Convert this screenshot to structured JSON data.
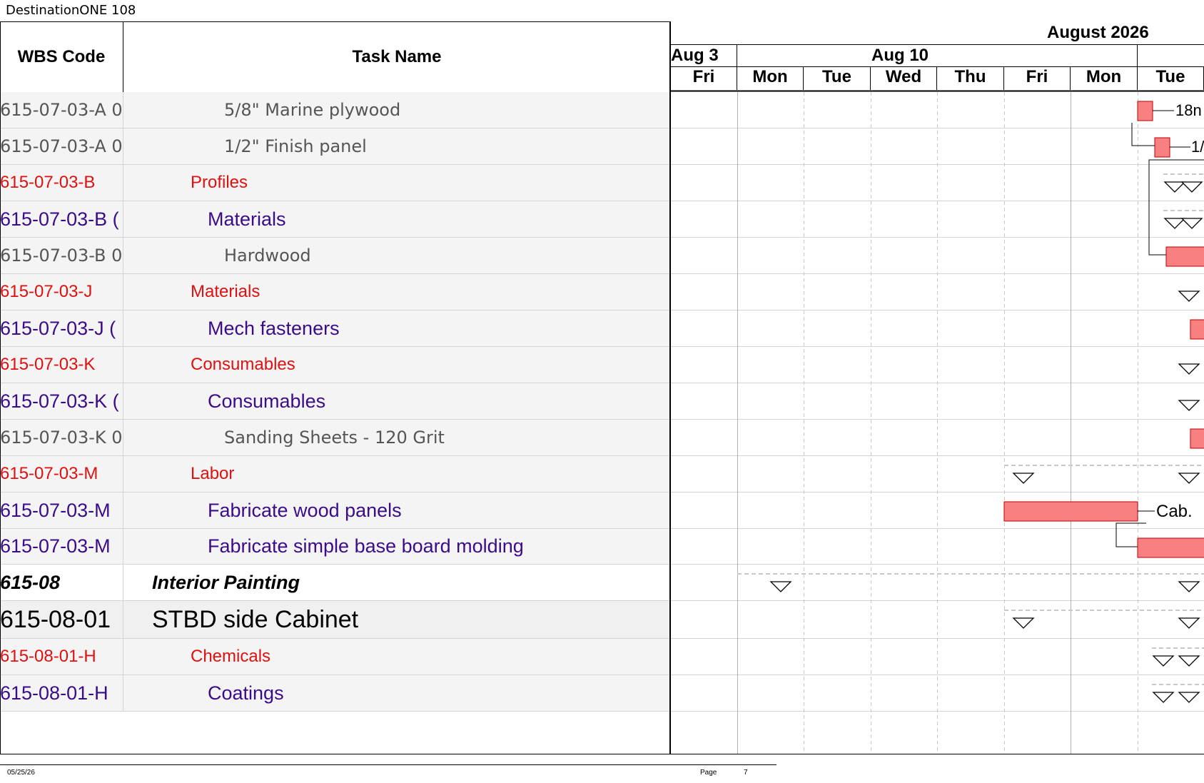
{
  "app": {
    "title": "DestinationONE 108"
  },
  "columns": {
    "wbs": "WBS Code",
    "task": "Task Name"
  },
  "timeline": {
    "month": "August 2026",
    "weeks": [
      "Aug 3",
      "Aug 10"
    ],
    "days": [
      "Fri",
      "Mon",
      "Tue",
      "Wed",
      "Thu",
      "Fri",
      "Mon",
      "Tue"
    ]
  },
  "rows": [
    {
      "wbs": "615-07-03-A 0",
      "task": "5/8\" Marine plywood",
      "style": "gray",
      "indent": 3
    },
    {
      "wbs": "615-07-03-A 0",
      "task": "1/2\" Finish panel",
      "style": "gray",
      "indent": 3
    },
    {
      "wbs": "615-07-03-B",
      "task": "Profiles",
      "style": "red",
      "indent": 1
    },
    {
      "wbs": "615-07-03-B (",
      "task": "Materials",
      "style": "purple",
      "indent": 2
    },
    {
      "wbs": "615-07-03-B 0",
      "task": "Hardwood",
      "style": "gray",
      "indent": 3
    },
    {
      "wbs": "615-07-03-J",
      "task": "Materials",
      "style": "red",
      "indent": 1
    },
    {
      "wbs": "615-07-03-J (",
      "task": "Mech fasteners",
      "style": "purple",
      "indent": 2
    },
    {
      "wbs": "615-07-03-K",
      "task": "Consumables",
      "style": "red",
      "indent": 1
    },
    {
      "wbs": "615-07-03-K (",
      "task": "Consumables",
      "style": "purple",
      "indent": 2
    },
    {
      "wbs": "615-07-03-K 0",
      "task": "Sanding Sheets - 120 Grit",
      "style": "gray",
      "indent": 3
    },
    {
      "wbs": "615-07-03-M",
      "task": "Labor",
      "style": "red",
      "indent": 1
    },
    {
      "wbs": "615-07-03-M",
      "task": "Fabricate wood panels",
      "style": "purple",
      "indent": 2
    },
    {
      "wbs": "615-07-03-M",
      "task": "Fabricate simple base board molding",
      "style": "purple",
      "indent": 2
    },
    {
      "wbs": "615-08",
      "task": "Interior Painting",
      "style": "bold",
      "indent": 0
    },
    {
      "wbs": "615-08-01",
      "task": "STBD side Cabinet",
      "style": "big",
      "indent": 0
    },
    {
      "wbs": "615-08-01-H",
      "task": "Chemicals",
      "style": "red",
      "indent": 1
    },
    {
      "wbs": "615-08-01-H",
      "task": "Coatings",
      "style": "purple",
      "indent": 2
    }
  ],
  "bar_labels": {
    "row0": "18n",
    "row1": "1/",
    "row11": "Cab."
  },
  "colors": {
    "bar": "#f88080",
    "bar_border": "#c00000",
    "red_text": "#e01010",
    "purple_text": "#3a0c8a"
  },
  "footer": {
    "date": "05/25/26",
    "page_label": "Page",
    "page_number": "7"
  }
}
